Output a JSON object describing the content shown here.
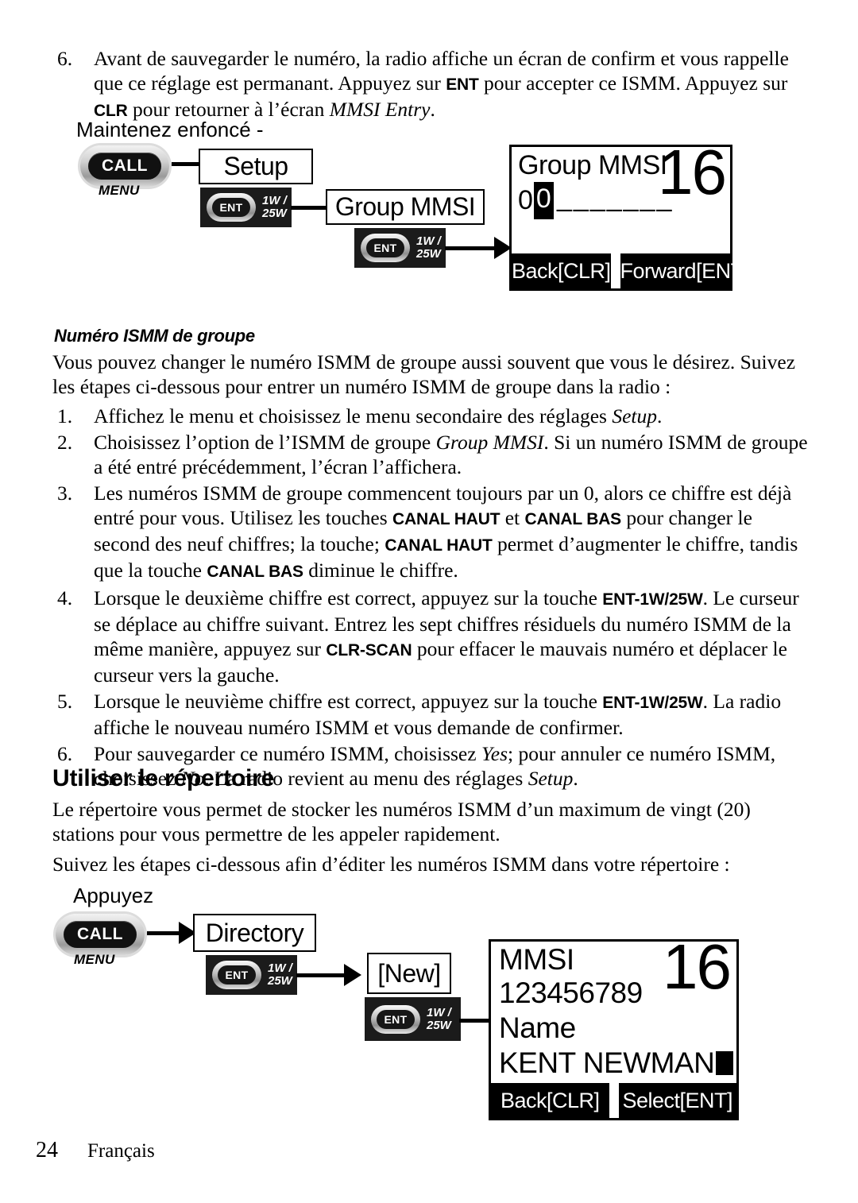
{
  "document": {
    "page_number": "24",
    "language_footer": "Français"
  },
  "top_step": {
    "number": "6.",
    "text_part1": "Avant de sauvegarder le numéro, la radio affiche un écran de confirm et vous rappelle que ce réglage est permanant. Appuyez sur ",
    "kbd1": "ENT",
    "text_part2": " pour accepter ce ISMM. Appuyez sur ",
    "kbd2": "CLR",
    "text_part3": " pour retourner à l’écran ",
    "italic1": "MMSI Entry",
    "text_part4": "."
  },
  "diagram1": {
    "hold_label": "Maintenez enfoncé -",
    "call_key": "CALL",
    "call_sub": "MENU",
    "ent_key": "ENT",
    "ent_watts_line1": "1W /",
    "ent_watts_line2": "25W",
    "box1": "Setup",
    "box2": "Group MMSI",
    "lcd": {
      "title": "Group MMSI",
      "channel": "16",
      "digit_plain": "0",
      "digit_highlighted": "0",
      "remaining_dashes": "_______",
      "softkey_left": "Back[CLR]",
      "softkey_right": "Forward[ENT]"
    }
  },
  "section1": {
    "heading": "Numéro ISMM de groupe",
    "intro": "Vous pouvez changer le numéro ISMM de groupe aussi souvent que vous le désirez. Suivez les étapes ci-dessous pour entrer un numéro ISMM de groupe dans la radio :",
    "steps": [
      {
        "number": "1.",
        "parts": [
          {
            "type": "text",
            "value": "Affichez le menu et choisissez le menu secondaire des réglages "
          },
          {
            "type": "italic",
            "value": "Setup"
          },
          {
            "type": "text",
            "value": "."
          }
        ]
      },
      {
        "number": "2.",
        "parts": [
          {
            "type": "text",
            "value": "Choisissez l’option de l’ISMM de groupe "
          },
          {
            "type": "italic",
            "value": "Group MMSI"
          },
          {
            "type": "text",
            "value": ". Si un numéro ISMM de groupe a été entré précédemment, l’écran l’affichera."
          }
        ]
      },
      {
        "number": "3.",
        "parts": [
          {
            "type": "text",
            "value": "Les numéros ISMM de groupe commencent toujours par un 0, alors ce chiffre est déjà entré pour vous. Utilisez les touches "
          },
          {
            "type": "kbd",
            "value": "CANAL HAUT"
          },
          {
            "type": "text",
            "value": " et "
          },
          {
            "type": "kbd",
            "value": "CANAL BAS"
          },
          {
            "type": "text",
            "value": " pour changer le second des neuf chiffres; la touche; "
          },
          {
            "type": "kbd",
            "value": "CANAL HAUT"
          },
          {
            "type": "text",
            "value": " permet d’augmenter le chiffre, tandis que la touche "
          },
          {
            "type": "kbd",
            "value": "CANAL BAS"
          },
          {
            "type": "text",
            "value": " diminue le chiffre."
          }
        ]
      },
      {
        "number": "4.",
        "parts": [
          {
            "type": "text",
            "value": "Lorsque le deuxième chiffre est correct, appuyez sur la touche "
          },
          {
            "type": "kbd",
            "value": "ENT-1W/25W"
          },
          {
            "type": "text",
            "value": ". Le curseur se déplace au chiffre suivant. Entrez les sept chiffres résiduels du numéro ISMM de la même manière, appuyez sur "
          },
          {
            "type": "kbd",
            "value": "CLR-SCAN"
          },
          {
            "type": "text",
            "value": " pour effacer le mauvais numéro et déplacer le curseur vers la gauche."
          }
        ]
      },
      {
        "number": "5.",
        "parts": [
          {
            "type": "text",
            "value": "Lorsque le neuvième chiffre est correct, appuyez sur la touche "
          },
          {
            "type": "kbd",
            "value": "ENT-1W/25W"
          },
          {
            "type": "text",
            "value": ". La radio affiche le nouveau numéro ISMM et vous demande de confirmer."
          }
        ]
      },
      {
        "number": "6.",
        "parts": [
          {
            "type": "text",
            "value": "Pour sauvegarder ce numéro ISMM, choisissez "
          },
          {
            "type": "italic",
            "value": "Yes"
          },
          {
            "type": "text",
            "value": "; pour annuler ce numéro ISMM, choisissez "
          },
          {
            "type": "italic",
            "value": "No"
          },
          {
            "type": "text",
            "value": ". La radio revient au menu des réglages "
          },
          {
            "type": "italic",
            "value": "Setup"
          },
          {
            "type": "text",
            "value": "."
          }
        ]
      }
    ]
  },
  "section2": {
    "heading": "Utiliser le répertoire",
    "para1": "Le répertoire vous permet de stocker les numéros ISMM d’un maximum de vingt (20) stations pour vous permettre de les appeler rapidement.",
    "para2": "Suivez les étapes ci-dessous afin d’éditer les numéros ISMM dans votre répertoire :"
  },
  "diagram2": {
    "press_label": "Appuyez",
    "call_key": "CALL",
    "call_sub": "MENU",
    "ent_key": "ENT",
    "ent_watts_line1": "1W /",
    "ent_watts_line2": "25W",
    "box1": "Directory",
    "box2": "[New]",
    "lcd": {
      "label_mmsi": "MMSI",
      "value_mmsi": "123456789",
      "label_name": "Name",
      "value_name": "KENT NEWMAN",
      "channel": "16",
      "softkey_left": "Back[CLR]",
      "softkey_right": "Select[ENT]"
    }
  }
}
